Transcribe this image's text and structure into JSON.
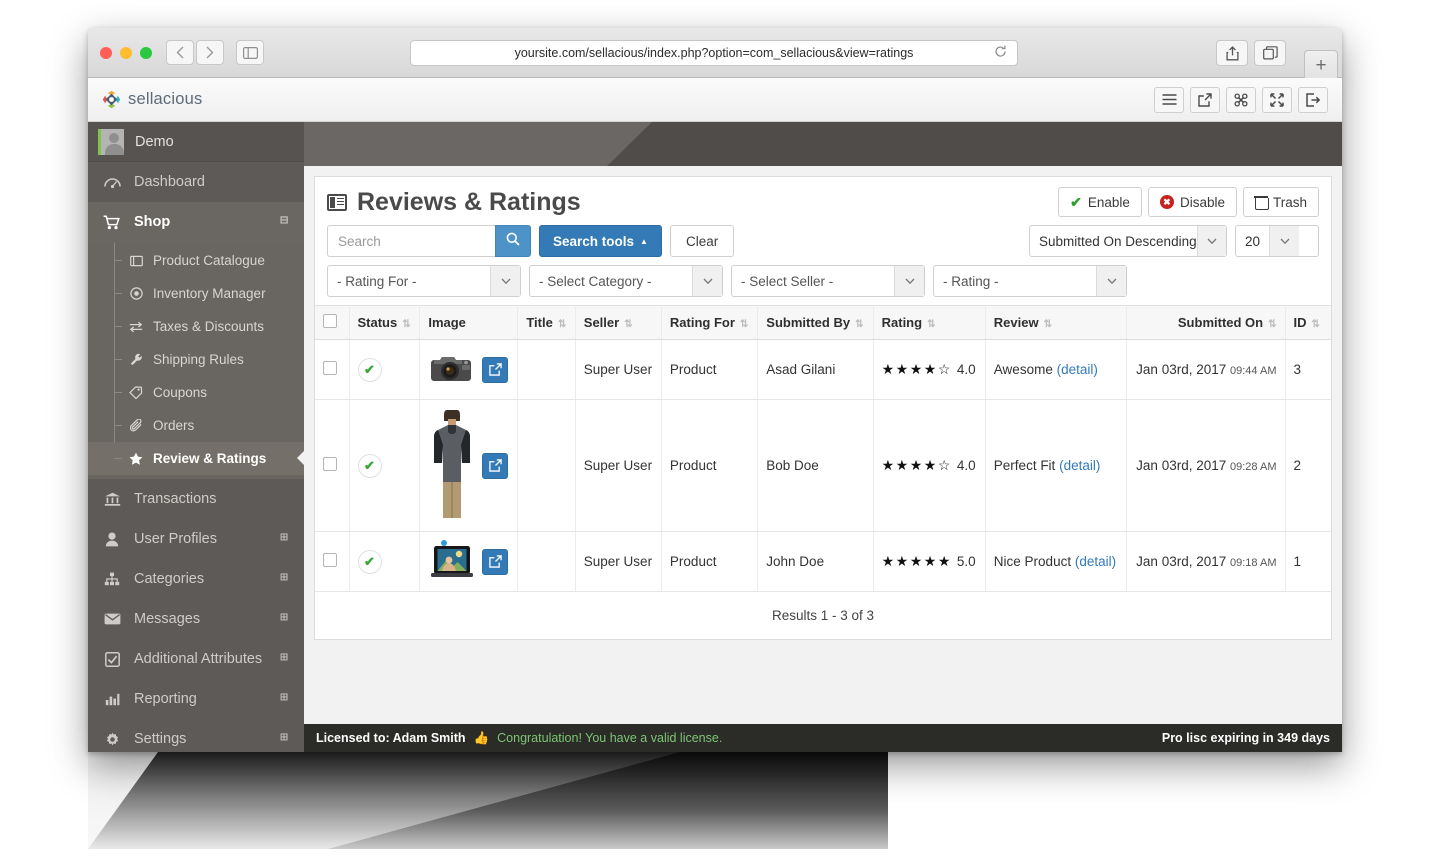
{
  "browser": {
    "url": "yoursite.com/sellacious/index.php?option=com_sellacious&view=ratings",
    "back_icon": "‹",
    "forward_icon": "›",
    "sidebar_icon": "sidebar",
    "reload_icon": "↻",
    "share_icon": "share",
    "tabs_icon": "tabs",
    "newtab_label": "+"
  },
  "app": {
    "brand": "sellacious",
    "header_icons": [
      "hamburger-menu",
      "external-link",
      "joomla",
      "fullscreen",
      "logout"
    ]
  },
  "sidebar": {
    "user": "Demo",
    "items": [
      {
        "label": "Dashboard",
        "icon": "dashboard-gauge-icon",
        "expandable": false,
        "active": false
      },
      {
        "label": "Shop",
        "icon": "cart-icon",
        "expandable": true,
        "active": true,
        "collapse_glyph": "⊟"
      },
      {
        "label": "Transactions",
        "icon": "bank-icon",
        "expandable": false,
        "active": false
      },
      {
        "label": "User Profiles",
        "icon": "user-icon",
        "expandable": true,
        "active": false,
        "collapse_glyph": "⊞"
      },
      {
        "label": "Categories",
        "icon": "sitemap-icon",
        "expandable": true,
        "active": false,
        "collapse_glyph": "⊞"
      },
      {
        "label": "Messages",
        "icon": "envelope-icon",
        "expandable": true,
        "active": false,
        "collapse_glyph": "⊞"
      },
      {
        "label": "Additional Attributes",
        "icon": "checkbox-icon",
        "expandable": true,
        "active": false,
        "collapse_glyph": "⊞"
      },
      {
        "label": "Reporting",
        "icon": "bar-chart-icon",
        "expandable": true,
        "active": false,
        "collapse_glyph": "⊞"
      },
      {
        "label": "Settings",
        "icon": "gear-icon",
        "expandable": true,
        "active": false,
        "collapse_glyph": "⊞"
      }
    ],
    "shop_submenu": [
      {
        "label": "Product Catalogue",
        "icon": "book-icon",
        "selected": false
      },
      {
        "label": "Inventory Manager",
        "icon": "circle-dot-icon",
        "selected": false
      },
      {
        "label": "Taxes & Discounts",
        "icon": "exchange-icon",
        "selected": false
      },
      {
        "label": "Shipping Rules",
        "icon": "wrench-icon",
        "selected": false
      },
      {
        "label": "Coupons",
        "icon": "tags-icon",
        "selected": false
      },
      {
        "label": "Orders",
        "icon": "paperclip-icon",
        "selected": false
      },
      {
        "label": "Review & Ratings",
        "icon": "star-half-icon",
        "selected": true
      }
    ]
  },
  "page": {
    "title": "Reviews & Ratings",
    "title_icon": "list-icon",
    "actions": [
      {
        "label": "Enable",
        "icon": "check-icon",
        "color": "#2f9e2f"
      },
      {
        "label": "Disable",
        "icon": "x-circle-icon",
        "color": "#c9211e"
      },
      {
        "label": "Trash",
        "icon": "trash-icon",
        "color": "#3b3b3b"
      }
    ]
  },
  "search": {
    "placeholder": "Search",
    "value": "",
    "search_icon": "magnifier-icon",
    "tools_label": "Search tools",
    "tools_caret": "▲",
    "clear_label": "Clear",
    "sort_value": "Submitted On Descending",
    "limit_value": "20",
    "caret": "⌄"
  },
  "filters": [
    {
      "name": "rating-for",
      "value": "- Rating For -"
    },
    {
      "name": "select-category",
      "value": "- Select Category -"
    },
    {
      "name": "select-seller",
      "value": "- Select Seller -"
    },
    {
      "name": "rating",
      "value": "- Rating -"
    }
  ],
  "table": {
    "columns": [
      {
        "label": "",
        "sortable": false,
        "key": "check"
      },
      {
        "label": "Status",
        "sortable": true
      },
      {
        "label": "Image",
        "sortable": false
      },
      {
        "label": "Title",
        "sortable": true
      },
      {
        "label": "Seller",
        "sortable": true
      },
      {
        "label": "Rating For",
        "sortable": true
      },
      {
        "label": "Submitted By",
        "sortable": true
      },
      {
        "label": "Rating",
        "sortable": true
      },
      {
        "label": "Review",
        "sortable": true
      },
      {
        "label": "Submitted On",
        "sortable": true
      },
      {
        "label": "ID",
        "sortable": true
      }
    ],
    "sort_glyph": "⇅",
    "rows": [
      {
        "status": "published",
        "status_icon": "check-icon",
        "image": "camera-thumbnail",
        "edit_icon": "external-link-icon",
        "title": "",
        "seller": "Super User",
        "rating_for": "Product",
        "submitted_by": "Asad Gilani",
        "rating_value": "4.0",
        "stars_filled": 4,
        "stars_total": 5,
        "review": "Awesome",
        "review_link": "(detail)",
        "submitted_on_date": "Jan 03rd, 2017",
        "submitted_on_time": "09:44 AM",
        "id": "3"
      },
      {
        "status": "published",
        "status_icon": "check-icon",
        "image": "tshirt-model-thumbnail",
        "edit_icon": "external-link-icon",
        "title": "",
        "seller": "Super User",
        "rating_for": "Product",
        "submitted_by": "Bob Doe",
        "rating_value": "4.0",
        "stars_filled": 4,
        "stars_total": 5,
        "review": "Perfect Fit",
        "review_link": "(detail)",
        "submitted_on_date": "Jan 03rd, 2017",
        "submitted_on_time": "09:28 AM",
        "id": "2"
      },
      {
        "status": "published",
        "status_icon": "check-icon",
        "image": "tablet-photo-thumbnail",
        "edit_icon": "external-link-icon",
        "title": "",
        "seller": "Super User",
        "rating_for": "Product",
        "submitted_by": "John Doe",
        "rating_value": "5.0",
        "stars_filled": 5,
        "stars_total": 5,
        "review": "Nice Product",
        "review_link": "(detail)",
        "submitted_on_date": "Jan 03rd, 2017",
        "submitted_on_time": "09:18 AM",
        "id": "1"
      }
    ],
    "results_text": "Results 1 - 3 of 3"
  },
  "statusbar": {
    "licensed_to": "Licensed to: Adam Smith",
    "thumbs_icon": "thumbs-up-icon",
    "message": "Congratulation! You have a valid license.",
    "expiry": "Pro lisc expiring in 349 days"
  },
  "colors": {
    "primary": "#337ab7",
    "success": "#2f9e2f",
    "danger": "#c9211e",
    "sidebar": "#5d5a57"
  }
}
